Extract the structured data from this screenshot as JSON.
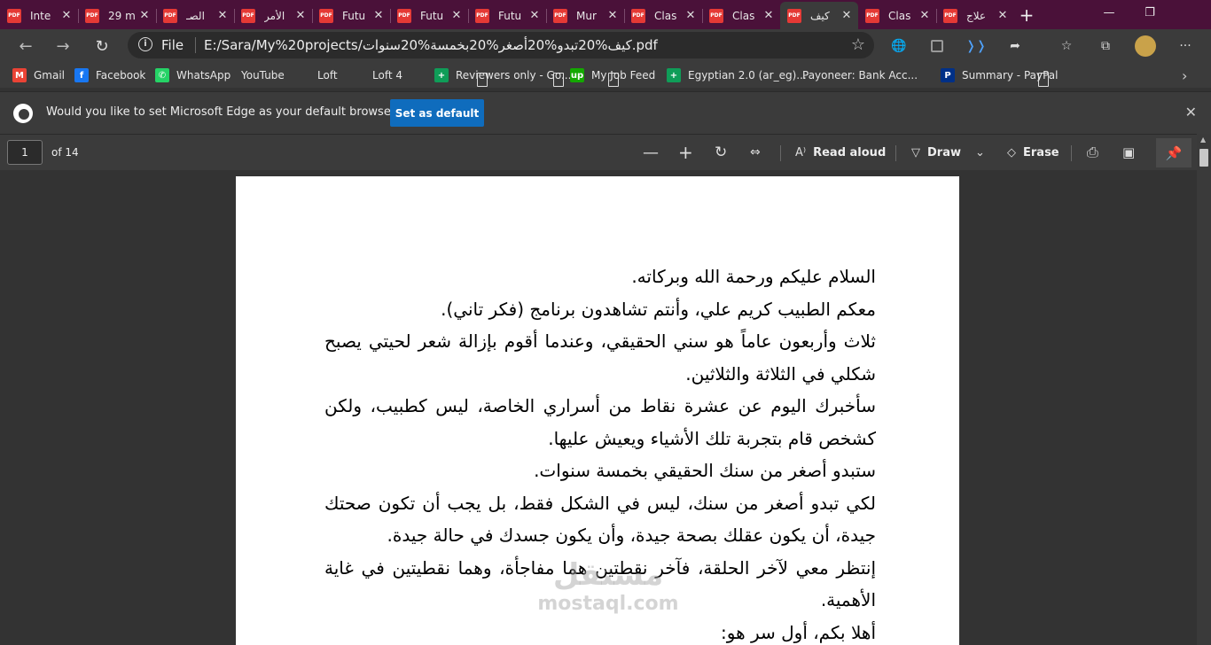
{
  "tabs": [
    {
      "label": "Inte",
      "active": false
    },
    {
      "label": "29 m",
      "active": false
    },
    {
      "label": "الصـ",
      "active": false
    },
    {
      "label": "الأمر",
      "active": false
    },
    {
      "label": "Futu",
      "active": false
    },
    {
      "label": "Futu",
      "active": false
    },
    {
      "label": "Futu",
      "active": false
    },
    {
      "label": "Mur",
      "active": false
    },
    {
      "label": "Clas",
      "active": false
    },
    {
      "label": "Clas",
      "active": false
    },
    {
      "label": "كيف",
      "active": true
    },
    {
      "label": "Clas",
      "active": false
    },
    {
      "label": "علاج",
      "active": false
    }
  ],
  "tab_icon_text": "PDF",
  "address": {
    "scheme_label": "File",
    "url": "E:/Sara/My%20projects/كيف%20تبدو%20أصغر%20بخمسة%20سنوات.pdf"
  },
  "bookmarks": [
    {
      "label": "Gmail",
      "icon": "gmail-icon",
      "color": "#ea4335",
      "glyph": "M"
    },
    {
      "label": "Facebook",
      "icon": "facebook-icon",
      "color": "#1877f2",
      "glyph": "f"
    },
    {
      "label": "WhatsApp",
      "icon": "whatsapp-icon",
      "color": "#25d366",
      "glyph": "✆"
    },
    {
      "label": "YouTube",
      "icon": "page-icon",
      "color": "",
      "glyph": ""
    },
    {
      "label": "Loft",
      "icon": "page-icon",
      "color": "",
      "glyph": ""
    },
    {
      "label": "Loft 4",
      "icon": "page-icon",
      "color": "",
      "glyph": ""
    },
    {
      "label": "Reviewers only - Go...",
      "icon": "sheets-icon",
      "color": "#0f9d58",
      "glyph": "+"
    },
    {
      "label": "My Job Feed",
      "icon": "upwork-icon",
      "color": "#14a800",
      "glyph": "up"
    },
    {
      "label": "Egyptian 2.0 (ar_eg)...",
      "icon": "sheets-icon",
      "color": "#0f9d58",
      "glyph": "+"
    },
    {
      "label": "Payoneer: Bank Acc...",
      "icon": "page-icon",
      "color": "",
      "glyph": ""
    },
    {
      "label": "Summary - PayPal",
      "icon": "paypal-icon",
      "color": "#003087",
      "glyph": "P"
    }
  ],
  "infobar": {
    "message": "Would you like to set Microsoft Edge as your default browser?",
    "button": "Set as default"
  },
  "pdf_toolbar": {
    "page": "1",
    "of": "of 14",
    "read_aloud": "Read aloud",
    "draw": "Draw",
    "erase": "Erase"
  },
  "document": {
    "paragraphs": [
      "السلام عليكم ورحمة الله وبركاته.",
      "معكم الطبيب كريم علي، وأنتم تشاهدون برنامج (فكر تاني).",
      "ثلاث وأربعون عاماً هو سني الحقيقي، وعندما أقوم بإزالة شعر لحيتي يصبح شكلي في الثلاثة والثلاثين.",
      "سأخبرك اليوم عن عشرة نقاط من أسراري الخاصة، ليس كطبيب، ولكن كشخص قام بتجربة تلك الأشياء ويعيش عليها.",
      "ستبدو أصغر من سنك الحقيقي بخمسة سنوات.",
      "لكي تبدو أصغر من سنك، ليس في الشكل فقط، بل يجب أن تكون صحتك جيدة، أن يكون عقلك بصحة جيدة، وأن يكون جسدك في حالة جيدة.",
      "إنتظر معي لآخر الحلقة، فآخر نقطتين هما مفاجأة، وهما نقطيتين في غاية الأهمية.",
      "أهلا بكم، أول سر هو:"
    ]
  },
  "watermark": {
    "arabic": "مستقل",
    "latin": "mostaql.com"
  }
}
